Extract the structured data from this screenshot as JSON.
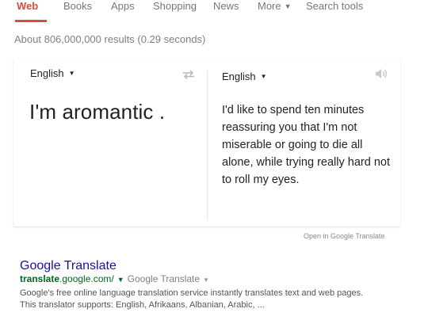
{
  "tabs": [
    {
      "label": "Web",
      "active": true
    },
    {
      "label": "Books"
    },
    {
      "label": "Apps"
    },
    {
      "label": "Shopping"
    },
    {
      "label": "News"
    },
    {
      "label": "More",
      "icon": "caret-down-icon"
    },
    {
      "label": "Search tools"
    }
  ],
  "stats": "About 806,000,000 results (0.29 seconds)",
  "translate_card": {
    "source_language": "English",
    "target_language": "English",
    "swap_icon": "swap-arrows-icon",
    "speaker_icon": "speaker-icon",
    "source_text": "I'm aromantic .",
    "target_lines": [
      "I'd like to spend ten minutes",
      "reassuring you that I'm not",
      "miserable or going to die all",
      "alone, while trying really hard not",
      "to roll my eyes."
    ],
    "open_link": "Open in Google Translate"
  },
  "result": {
    "title": "Google Translate",
    "url_bold": "translate",
    "url_rest": ".google.com/",
    "breadcrumb": "Google Translate",
    "snippet_lines": [
      "Google's free online language translation service instantly translates text and web pages.",
      "This translator supports: English, Afrikaans, Albanian, Arabic, ..."
    ]
  },
  "colors": {
    "active_tab": "#dd4b39",
    "result_title": "#1a0dab",
    "result_url": "#006621"
  }
}
